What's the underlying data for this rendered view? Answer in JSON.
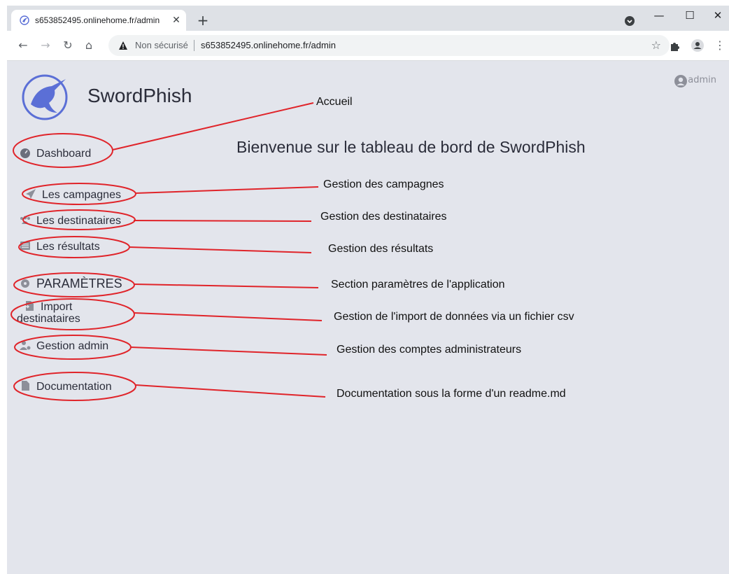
{
  "browser": {
    "tab_title": "s653852495.onlinehome.fr/admin",
    "tab_close": "✕",
    "new_tab": "+",
    "not_secure": "Non sécurisé",
    "url": "s653852495.onlinehome.fr/admin",
    "window_controls": {
      "minimize": "—",
      "maximize": "☐",
      "close": "✕"
    }
  },
  "app": {
    "brand": "SwordPhish",
    "user": "admin",
    "heading": "Bienvenue sur le tableau de bord de SwordPhish"
  },
  "sidebar": {
    "dashboard": "Dashboard",
    "campaigns": "Les campagnes",
    "recipients": "Les destinataires",
    "results": "Les résultats",
    "settings_section": "PARAMÈTRES",
    "import_line1": "Import",
    "import_line2": "destinataires",
    "admin_management": "Gestion admin",
    "documentation": "Documentation"
  },
  "annotations": {
    "dashboard": "Accueil",
    "campaigns": "Gestion des campagnes",
    "recipients": "Gestion des destinataires",
    "results": "Gestion des résultats",
    "settings": "Section paramètres de l'application",
    "import": "Gestion de l'import de données via un fichier csv",
    "admin": "Gestion des comptes administrateurs",
    "documentation": "Documentation sous la forme d'un readme.md"
  },
  "colors": {
    "page_bg": "#e3e5ec",
    "annotation_red": "#e0242a",
    "icon_gray": "#7b7f8c",
    "logo_blue": "#5b6fd6"
  }
}
